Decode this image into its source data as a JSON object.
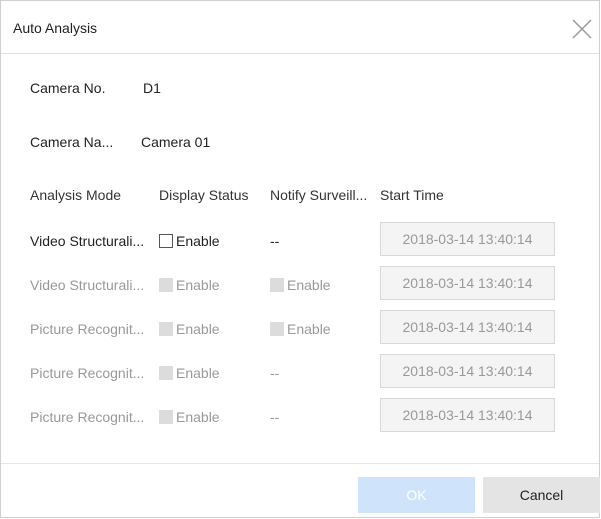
{
  "dialog": {
    "title": "Auto Analysis",
    "close_icon": "close-icon"
  },
  "fields": {
    "camera_no_label": "Camera No.",
    "camera_no_value": "D1",
    "camera_name_label": "Camera Na...",
    "camera_name_value": "Camera 01"
  },
  "table": {
    "headers": [
      "Analysis Mode",
      "Display Status",
      "Notify Surveill...",
      "Start Time"
    ],
    "rows": [
      {
        "mode": "Video Structurali...",
        "display_status": "Enable",
        "notify": "--",
        "start_time": "2018-03-14 13:40:14",
        "enabled": true
      },
      {
        "mode": "Video Structurali...",
        "display_status": "Enable",
        "notify": "Enable",
        "start_time": "2018-03-14 13:40:14",
        "enabled": false
      },
      {
        "mode": "Picture Recognit...",
        "display_status": "Enable",
        "notify": "Enable",
        "start_time": "2018-03-14 13:40:14",
        "enabled": false
      },
      {
        "mode": "Picture Recognit...",
        "display_status": "Enable",
        "notify": "--",
        "start_time": "2018-03-14 13:40:14",
        "enabled": false
      },
      {
        "mode": "Picture Recognit...",
        "display_status": "Enable",
        "notify": "--",
        "start_time": "2018-03-14 13:40:14",
        "enabled": false
      }
    ]
  },
  "buttons": {
    "ok": "OK",
    "cancel": "Cancel"
  },
  "colors": {
    "ok_button_bg": "#cfe3fb",
    "cancel_button_bg": "#e4e4e4",
    "disabled_text": "#999999"
  }
}
